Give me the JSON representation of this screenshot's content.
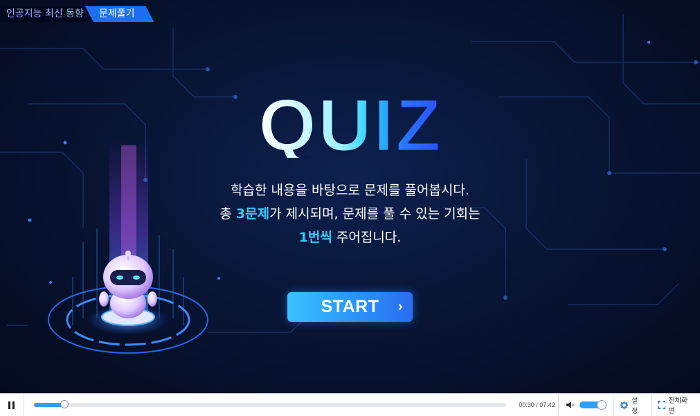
{
  "breadcrumb": {
    "course": "인공지능 최신 동향",
    "current": "문제풀기"
  },
  "title": "QUIZ",
  "intro": {
    "line1": "학습한 내용을 바탕으로 문제를 풀어봅시다.",
    "line2_pre": "총 ",
    "line2_hl": "3문제",
    "line2_post": "가 제시되며, 문제를 풀 수 있는 기회는",
    "line3_hl": "1번씩",
    "line3_post": " 주어집니다."
  },
  "start_button": {
    "label": "START"
  },
  "player": {
    "time": "00:30 / 07:42",
    "progress_fraction": 0.065,
    "volume_fraction": 1.0,
    "settings_label": "설정",
    "fullscreen_label": "전체화면"
  },
  "colors": {
    "accent": "#2f9ef5",
    "highlight": "#39c8ff",
    "crumb_active": "#1d6ff2"
  }
}
